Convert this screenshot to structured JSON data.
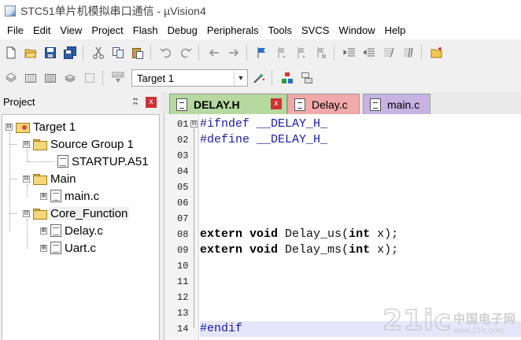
{
  "window": {
    "title": "STC51单片机模拟串口通信 - µVision4"
  },
  "menu": [
    "File",
    "Edit",
    "View",
    "Project",
    "Flash",
    "Debug",
    "Peripherals",
    "Tools",
    "SVCS",
    "Window",
    "Help"
  ],
  "toolbar1": {
    "icons": [
      "new-file-icon",
      "open-folder-icon",
      "save-icon",
      "save-all-icon",
      "cut-icon",
      "copy-icon",
      "paste-icon",
      "undo-icon",
      "redo-icon",
      "nav-back-icon",
      "nav-forward-icon",
      "bookmark-icon",
      "prev-bookmark-icon",
      "next-bookmark-icon",
      "clear-bookmarks-icon",
      "indent-icon",
      "unindent-icon",
      "comment-icon",
      "uncomment-icon",
      "find-in-files-icon"
    ]
  },
  "toolbar2": {
    "icons": [
      "translate-icon",
      "build-icon",
      "rebuild-icon",
      "batch-build-icon",
      "stop-build-icon",
      "download-icon"
    ],
    "target_select": {
      "value": "Target 1"
    },
    "icons_after": [
      "target-options-icon",
      "manage-components-icon",
      "select-packs-icon"
    ],
    "load_label": "LOAD"
  },
  "project_panel": {
    "title": "Project",
    "pin": "ʭ",
    "close": "x",
    "tree": [
      {
        "label": "Target 1",
        "type": "target",
        "level": 0,
        "expander": "⊟"
      },
      {
        "label": "Source Group 1",
        "type": "folder",
        "level": 1,
        "expander": "⊟"
      },
      {
        "label": "STARTUP.A51",
        "type": "file",
        "level": 2,
        "expander": ""
      },
      {
        "label": "Main",
        "type": "folder",
        "level": 1,
        "expander": "⊟"
      },
      {
        "label": "main.c",
        "type": "file",
        "level": 2,
        "expander": "⊞"
      },
      {
        "label": "Core_Function",
        "type": "folder",
        "level": 1,
        "expander": "⊟"
      },
      {
        "label": "Delay.c",
        "type": "file",
        "level": 2,
        "expander": "⊞"
      },
      {
        "label": "Uart.c",
        "type": "file",
        "level": 2,
        "expander": "⊞"
      }
    ]
  },
  "tabs": [
    {
      "label": "DELAY.H",
      "active": true,
      "color": "#b5d99f",
      "close": "x"
    },
    {
      "label": "Delay.c",
      "active": false,
      "color": "#f2a9a9"
    },
    {
      "label": "main.c",
      "active": false,
      "color": "#c6b3e2"
    }
  ],
  "editor": {
    "lines": [
      {
        "no": "01",
        "text": "#ifndef __DELAY_H_"
      },
      {
        "no": "02",
        "text": "#define __DELAY_H_"
      },
      {
        "no": "03",
        "text": ""
      },
      {
        "no": "04",
        "text": ""
      },
      {
        "no": "05",
        "text": ""
      },
      {
        "no": "06",
        "text": ""
      },
      {
        "no": "07",
        "text": ""
      },
      {
        "no": "08",
        "text": "extern void Delay_us(int x);"
      },
      {
        "no": "09",
        "text": "extern void Delay_ms(int x);"
      },
      {
        "no": "10",
        "text": ""
      },
      {
        "no": "11",
        "text": ""
      },
      {
        "no": "12",
        "text": ""
      },
      {
        "no": "13",
        "text": ""
      },
      {
        "no": "14",
        "text": "#endif"
      }
    ],
    "current_line": "14",
    "fold_marker": "⊟"
  },
  "watermark": {
    "big": "21ic",
    "cn": "中国电子网",
    "en": "www.21ic.com"
  },
  "colors": {
    "preprocessor": "#1a1aa6",
    "current_line_bg": "#e6e6fa",
    "tab_active": "#b5d99f"
  }
}
